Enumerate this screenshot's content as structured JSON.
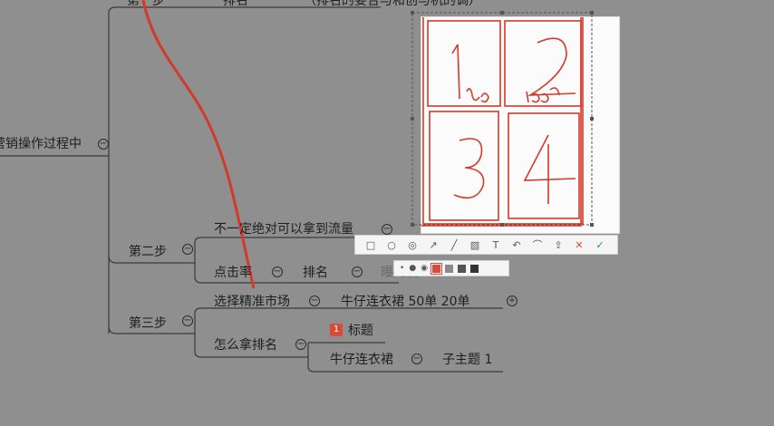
{
  "mindmap": {
    "top_partial_left": "第一步",
    "top_partial_mid": "排名",
    "top_partial_right": "（排名的要合与和创与机的调）",
    "root_topic": "营销操作过程中",
    "step2": {
      "label": "第二步",
      "branch_a": "不一定绝对可以拿到流量",
      "branch_b": "点击率",
      "branch_b_child": "排名",
      "branch_b_child2": "曝光度"
    },
    "step3": {
      "label": "第三步",
      "branch_a": "选择精准市场",
      "branch_a_child": "牛仔连衣裙  50单  20单",
      "branch_b": "怎么拿排名",
      "badge_number": "1",
      "badge_label": "标题",
      "branch_b_child": "牛仔连衣裙",
      "branch_b_child2": "子主题 1"
    }
  },
  "drawing": {
    "cells": [
      "1",
      "2",
      "3",
      "4"
    ],
    "note_cell1": "130",
    "note_cell2": "1000",
    "ink_color": "#d23a2a"
  },
  "annotation_toolbar": {
    "tools": [
      "□",
      "○",
      "◎",
      "↗",
      "╱",
      "▧",
      "T",
      "↶",
      "⌒",
      "⇪",
      "✕",
      "✓"
    ],
    "brush_sizes": [
      "•",
      "●",
      "◉"
    ],
    "colors": [
      "#d84a3a",
      "#8a8a8a",
      "#555555",
      "#333333"
    ]
  }
}
